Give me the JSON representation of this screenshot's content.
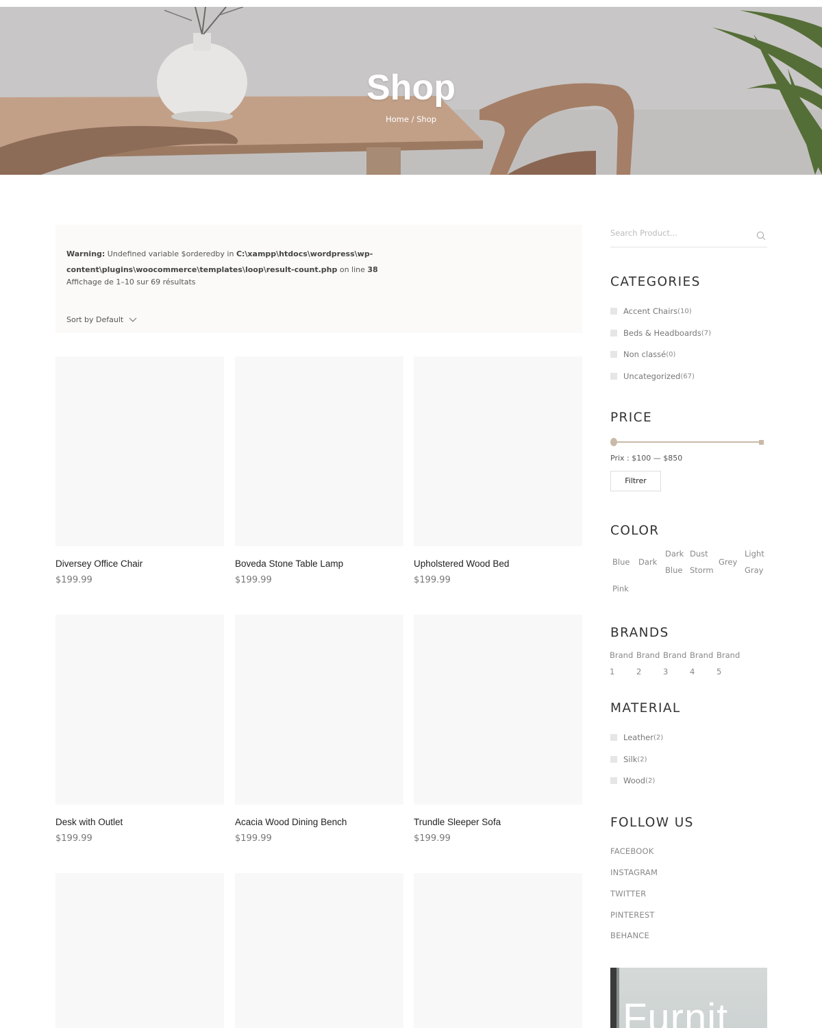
{
  "hero": {
    "title": "Shop",
    "breadcrumb": {
      "home": "Home",
      "separator": "/",
      "current": "Shop"
    }
  },
  "notice": {
    "warning_label": "Warning:",
    "warning_text": " Undefined variable $orderedby in ",
    "warning_path": "C:\\xampp\\htdocs\\wordpress\\wp-content\\plugins\\woocommerce\\templates\\loop\\result-count.php",
    "warning_on": " on line ",
    "warning_line": "38",
    "result_count": "Affichage de 1–10 sur 69 résultats",
    "sort_label": "Sort by Default"
  },
  "products": [
    {
      "name": "Diversey Office Chair",
      "price": "$199.99"
    },
    {
      "name": "Boveda Stone Table Lamp",
      "price": "$199.99"
    },
    {
      "name": "Upholstered Wood Bed",
      "price": "$199.99"
    },
    {
      "name": "Desk with Outlet",
      "price": "$199.99"
    },
    {
      "name": "Acacia Wood Dining Bench",
      "price": "$199.99"
    },
    {
      "name": "Trundle Sleeper Sofa",
      "price": "$199.99"
    },
    {
      "name": "",
      "price": ""
    },
    {
      "name": "",
      "price": ""
    },
    {
      "name": "",
      "price": ""
    }
  ],
  "sidebar": {
    "search_placeholder": "Search Product...",
    "categories_title": "CATEGORIES",
    "categories": [
      {
        "label": "Accent Chairs",
        "count": "(10)"
      },
      {
        "label": "Beds & Headboards",
        "count": "(7)"
      },
      {
        "label": "Non classé",
        "count": "(0)"
      },
      {
        "label": "Uncategorized",
        "count": "(67)"
      }
    ],
    "price_title": "PRICE",
    "price_label": "Prix : $100 — $850",
    "price_range": {
      "min": 100,
      "max": 850
    },
    "filter_button": "Filtrer",
    "color_title": "COLOR",
    "colors": [
      {
        "line1": "Blue",
        "line2": ""
      },
      {
        "line1": "Dark",
        "line2": ""
      },
      {
        "line1": "Dark",
        "line2": "Blue"
      },
      {
        "line1": "Dust",
        "line2": "Storm"
      },
      {
        "line1": "Grey",
        "line2": ""
      },
      {
        "line1": "Light",
        "line2": "Gray"
      },
      {
        "line1": "Pink",
        "line2": ""
      }
    ],
    "brands_title": "BRANDS",
    "brands": [
      {
        "line1": "Brand",
        "line2": "1"
      },
      {
        "line1": "Brand",
        "line2": "2"
      },
      {
        "line1": "Brand",
        "line2": "3"
      },
      {
        "line1": "Brand",
        "line2": "4"
      },
      {
        "line1": "Brand",
        "line2": "5"
      }
    ],
    "material_title": "MATERIAL",
    "materials": [
      {
        "label": "Leather",
        "count": " (2)"
      },
      {
        "label": "Silk",
        "count": " (2)"
      },
      {
        "label": "Wood",
        "count": " (2)"
      }
    ],
    "follow_title": "FOLLOW US",
    "social": [
      "FACEBOOK",
      "INSTAGRAM",
      "TWITTER",
      "PINTEREST",
      "BEHANCE"
    ],
    "promo_text": "Furnit"
  },
  "colors": {
    "accent": "#c9b9a7",
    "placeholder_bg": "#f8f8f8",
    "notice_bg": "#fbfaf8"
  }
}
